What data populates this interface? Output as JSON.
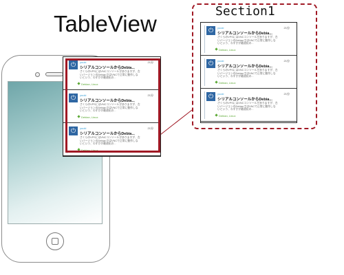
{
  "diagram": {
    "title": "TableView",
    "section_label": "Section1",
    "colors": {
      "highlight": "#a01824",
      "logo": "#2f67a3",
      "tag": "#5aa833",
      "user": "#3aa0d8"
    }
  },
  "cells": [
    {
      "user": "yuuki",
      "time": "21分",
      "title": "シリアルコンソールからDebia...",
      "body": "さくらのVPSにはVNCコンソールがありますが、古いバージョンのDebianではVNCで正常に動作しないという、わずかが最適化の...",
      "tags": "Debian, Linux"
    },
    {
      "user": "yuuki",
      "time": "21分",
      "title": "シリアルコンソールからDebia...",
      "body": "さくらのVPSにはVNCコンソールがありますが、古いバージョンのDebianではVNCで正常に動作しないという、わずかが最適化の...",
      "tags": "Debian, Linux"
    },
    {
      "user": "yuuki",
      "time": "21分",
      "title": "シリアルコンソールからDebia...",
      "body": "さくらのVPSにはVNCコンソールがありますが、古いバージョンのDebianではVNCで正常に動作しないという、わずかが最適化の...",
      "tags": "Debian, Linux"
    }
  ],
  "icons": {
    "cell_logo": "power-icon",
    "tag": "tag-icon",
    "phone_home": "home-button-icon"
  }
}
